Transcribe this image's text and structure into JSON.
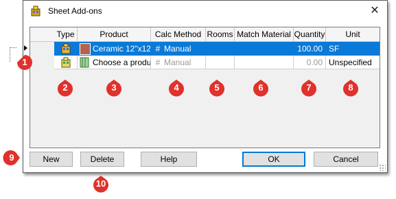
{
  "window": {
    "title": "Sheet Add-ons"
  },
  "grid": {
    "columns": [
      "Type",
      "Product",
      "Calc Method",
      "Rooms",
      "Match Material",
      "Quantity",
      "Unit"
    ],
    "rows": [
      {
        "product": "Ceramic 12\"x12",
        "calc_method": "Manual",
        "rooms": "",
        "match_material": "",
        "quantity": "100.00",
        "unit": "SF",
        "selected": true
      },
      {
        "product": "Choose a produ",
        "calc_method": "Manual",
        "rooms": "",
        "match_material": "",
        "quantity": "0.00",
        "unit": "Unspecified",
        "selected": false
      }
    ]
  },
  "buttons": {
    "new": "New",
    "delete": "Delete",
    "help": "Help",
    "ok": "OK",
    "cancel": "Cancel"
  },
  "callouts": [
    "1",
    "2",
    "3",
    "4",
    "5",
    "6",
    "7",
    "8",
    "9",
    "10"
  ],
  "colors": {
    "selection": "#0a7ad8",
    "callout": "#e0312c",
    "swatch": "#b5624f"
  }
}
